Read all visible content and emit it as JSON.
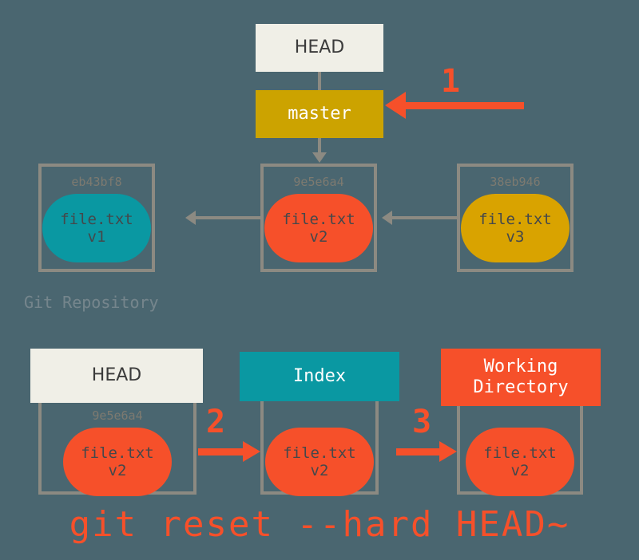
{
  "diagram": {
    "title": "git reset --hard HEAD~",
    "background_color": "#4a6670",
    "accent_color": "#f6502a"
  },
  "repository": {
    "label": "Git Repository",
    "refs": {
      "head_label": "HEAD",
      "branch_label": "master"
    },
    "commits": [
      {
        "hash": "eb43bf8",
        "file": "file.txt",
        "version": "v1",
        "color": "#0a98a2"
      },
      {
        "hash": "9e5e6a4",
        "file": "file.txt",
        "version": "v2",
        "color": "#f6502a"
      },
      {
        "hash": "38eb946",
        "file": "file.txt",
        "version": "v3",
        "color": "#d9a300"
      }
    ]
  },
  "steps": {
    "one": "1",
    "two": "2",
    "three": "3"
  },
  "areas": [
    {
      "title": "HEAD",
      "title_color": "#f0efe7",
      "hash": "9e5e6a4",
      "file": "file.txt",
      "version": "v2"
    },
    {
      "title": "Index",
      "title_color": "#0a98a2",
      "hash": "",
      "file": "file.txt",
      "version": "v2"
    },
    {
      "title_line1": "Working",
      "title_line2": "Directory",
      "title_color": "#f6502a",
      "hash": "",
      "file": "file.txt",
      "version": "v2"
    }
  ],
  "command": "git reset --hard HEAD~"
}
